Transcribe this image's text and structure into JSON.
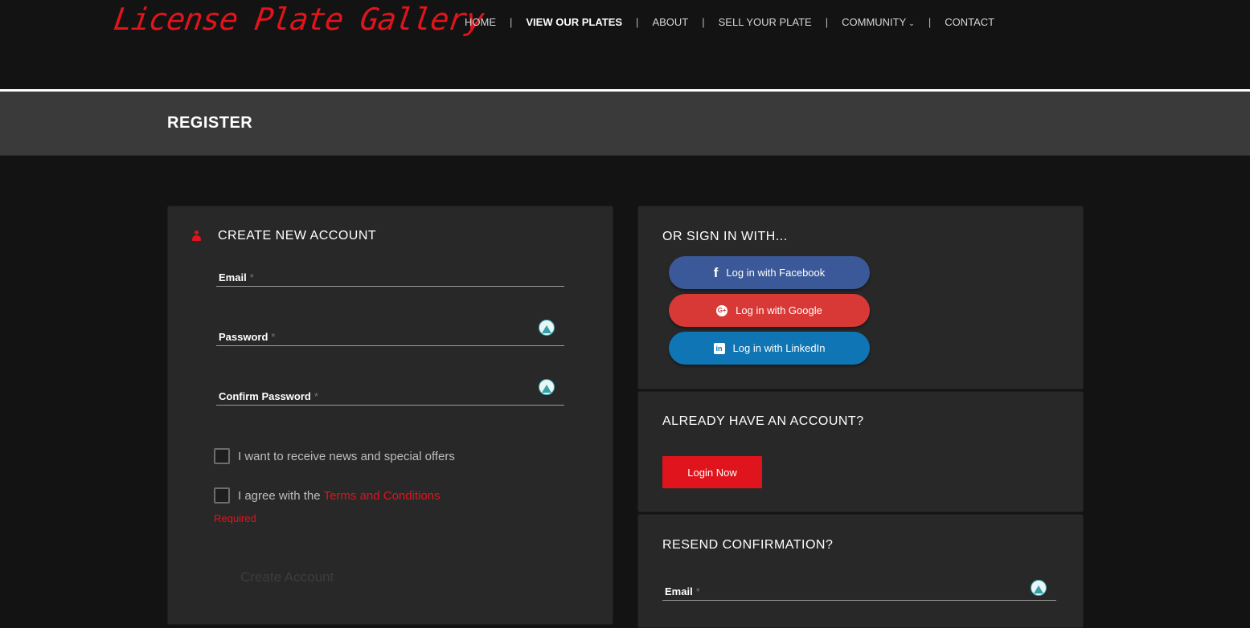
{
  "header": {
    "logo": "License Plate Gallery",
    "nav": [
      {
        "label": "HOME",
        "active": false
      },
      {
        "label": "VIEW OUR PLATES",
        "active": true
      },
      {
        "label": "ABOUT",
        "active": false
      },
      {
        "label": "SELL YOUR PLATE",
        "active": false
      },
      {
        "label": "COMMUNITY",
        "active": false,
        "dropdown": true
      },
      {
        "label": "CONTACT",
        "active": false
      }
    ]
  },
  "page": {
    "title": "REGISTER"
  },
  "register": {
    "title": "CREATE NEW ACCOUNT",
    "email_label": "Email",
    "password_label": "Password",
    "confirm_label": "Confirm Password",
    "required_mark": "*",
    "newsletter_label": "I want to receive news and special offers",
    "terms_prefix": "I agree with the",
    "terms_link": "Terms and Conditions",
    "required_text": "Required",
    "create_button": "Create Account"
  },
  "social": {
    "title": "OR SIGN IN WITH...",
    "facebook": "Log in with Facebook",
    "google": "Log in with Google",
    "linkedin": "Log in with LinkedIn"
  },
  "existing": {
    "title": "ALREADY HAVE AN ACCOUNT?",
    "login_button": "Login Now"
  },
  "resend": {
    "title": "RESEND CONFIRMATION?",
    "email_label": "Email"
  },
  "colors": {
    "accent": "#e0141c",
    "background": "#131313",
    "panel": "#282828",
    "facebook": "#3b5998",
    "google": "#d93936",
    "linkedin": "#0f75b4"
  },
  "icons": {
    "user": "user-icon",
    "facebook": "facebook-icon",
    "google": "google-plus-icon",
    "linkedin": "linkedin-icon",
    "password_manager": "password-manager-icon",
    "dropdown": "chevron-down-icon"
  }
}
